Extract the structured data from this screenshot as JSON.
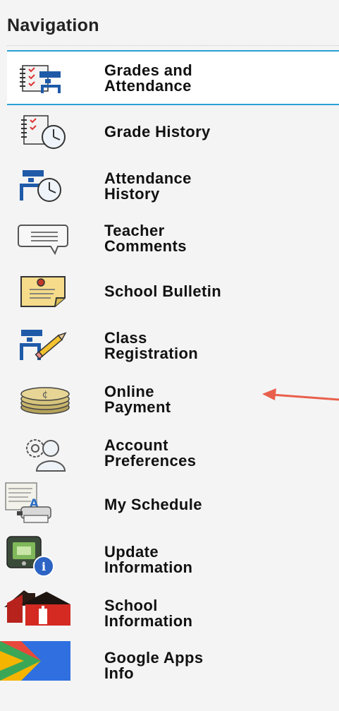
{
  "navigation": {
    "title": "Navigation",
    "items": [
      {
        "line1": "Grades and",
        "line2": "Attendance",
        "icon": "grades-attendance-icon",
        "selected": true
      },
      {
        "line1": "Grade History",
        "line2": "",
        "icon": "grade-history-icon"
      },
      {
        "line1": "Attendance",
        "line2": "History",
        "icon": "attendance-history-icon"
      },
      {
        "line1": "Teacher",
        "line2": "Comments",
        "icon": "teacher-comments-icon"
      },
      {
        "line1": "School Bulletin",
        "line2": "",
        "icon": "school-bulletin-icon"
      },
      {
        "line1": "Class",
        "line2": "Registration",
        "icon": "class-registration-icon"
      },
      {
        "line1": "Online",
        "line2": "Payment",
        "icon": "online-payment-icon"
      },
      {
        "line1": "Account",
        "line2": "Preferences",
        "icon": "account-preferences-icon"
      },
      {
        "line1": "My Schedule",
        "line2": "",
        "icon": "my-schedule-icon"
      },
      {
        "line1": "Update",
        "line2": "Information",
        "icon": "update-information-icon"
      },
      {
        "line1": "School",
        "line2": "Information",
        "icon": "school-information-icon"
      },
      {
        "line1": "Google Apps",
        "line2": "Info",
        "icon": "google-apps-icon"
      }
    ]
  },
  "colors": {
    "selected_border": "#29a0d6",
    "annotation_arrow": "#e8604c"
  }
}
